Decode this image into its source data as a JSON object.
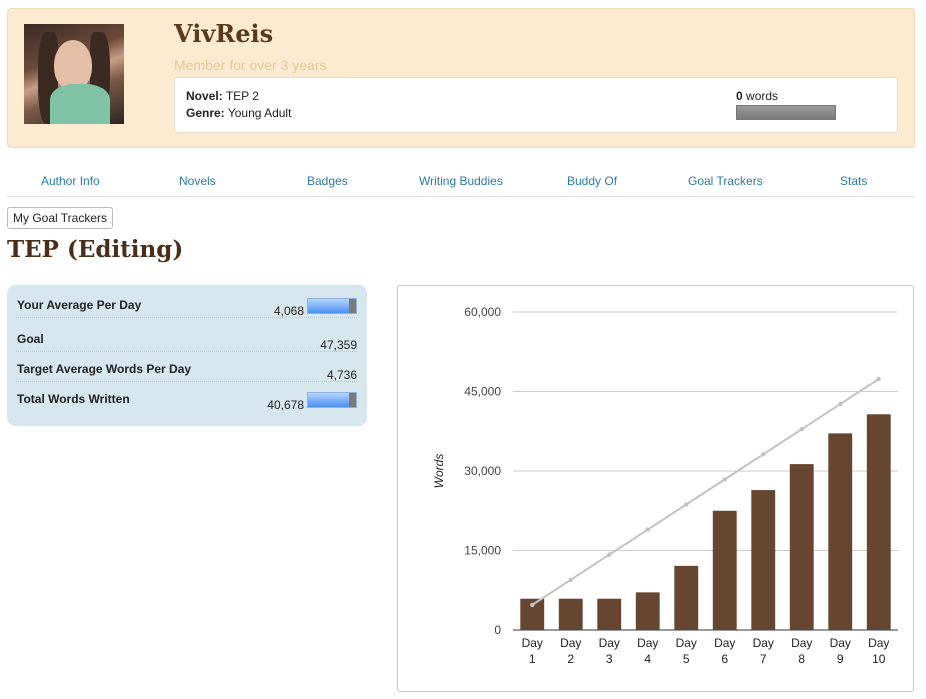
{
  "profile": {
    "username": "VivReis",
    "member_since": "Member for over 3 years",
    "novel_label": "Novel:",
    "novel_title": "TEP 2",
    "genre_label": "Genre:",
    "genre": "Young Adult",
    "word_count": "0",
    "word_count_unit": "words",
    "word_progress": 0
  },
  "nav": {
    "items": [
      {
        "label": "Author Info"
      },
      {
        "label": "Novels"
      },
      {
        "label": "Badges"
      },
      {
        "label": "Writing Buddies"
      },
      {
        "label": "Buddy Of"
      },
      {
        "label": "Goal Trackers"
      },
      {
        "label": "Stats"
      }
    ]
  },
  "my_goal_trackers_label": "My Goal Trackers",
  "page_title": "TEP (Editing)",
  "stats": {
    "average_per_day": {
      "label": "Your Average Per Day",
      "value": "4,068"
    },
    "goal": {
      "label": "Goal",
      "value": "47,359"
    },
    "target_average": {
      "label": "Target Average Words Per Day",
      "value": "4,736"
    },
    "total_written": {
      "label": "Total Words Written",
      "value": "40,678"
    }
  },
  "colors": {
    "bar": "#664631",
    "target_line": "#c2c2c2",
    "link": "#2a7aa8",
    "header_bg": "#fcebd0",
    "stats_bg": "#d7e7ee"
  },
  "chart_data": {
    "type": "bar",
    "ylabel": "Words",
    "ylim": [
      0,
      60000
    ],
    "yticks": [
      0,
      15000,
      30000,
      45000,
      60000
    ],
    "ytick_labels": [
      "0",
      "15,000",
      "30,000",
      "45,000",
      "60,000"
    ],
    "categories": [
      [
        "Day",
        "1"
      ],
      [
        "Day",
        "2"
      ],
      [
        "Day",
        "3"
      ],
      [
        "Day",
        "4"
      ],
      [
        "Day",
        "5"
      ],
      [
        "Day",
        "6"
      ],
      [
        "Day",
        "7"
      ],
      [
        "Day",
        "8"
      ],
      [
        "Day",
        "9"
      ],
      [
        "Day",
        "10"
      ]
    ],
    "series": [
      {
        "type": "bar",
        "values": [
          5900,
          5900,
          5900,
          7100,
          12100,
          22500,
          26400,
          31300,
          37100,
          40700
        ]
      },
      {
        "type": "line",
        "values": [
          4736,
          9472,
          14208,
          18944,
          23680,
          28416,
          33152,
          37888,
          42624,
          47359
        ]
      }
    ],
    "grid": true
  }
}
